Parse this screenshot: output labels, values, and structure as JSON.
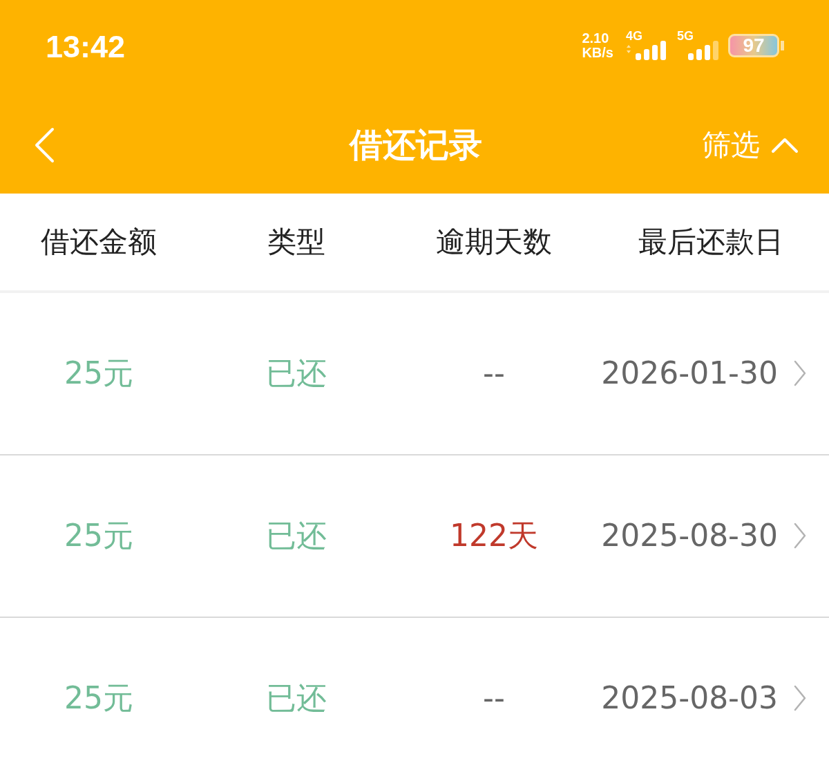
{
  "status_bar": {
    "time": "13:42",
    "network_speed": {
      "value": "2.10",
      "unit": "KB/s"
    },
    "signals": [
      {
        "label": "4G",
        "kind": "active"
      },
      {
        "label": "5G",
        "kind": "idle"
      }
    ],
    "battery": {
      "percent": "97"
    }
  },
  "nav_bar": {
    "title": "借还记录",
    "filter": {
      "label": "筛选",
      "expanded": true
    }
  },
  "table": {
    "columns": [
      "借还金额",
      "类型",
      "逾期天数",
      "最后还款日"
    ],
    "rows": [
      {
        "amount": "25元",
        "type": "已还",
        "overdue_days": "--",
        "overdue": false,
        "due_date": "2026-01-30"
      },
      {
        "amount": "25元",
        "type": "已还",
        "overdue_days": "122天",
        "overdue": true,
        "due_date": "2025-08-30"
      },
      {
        "amount": "25元",
        "type": "已还",
        "overdue_days": "--",
        "overdue": false,
        "due_date": "2025-08-03"
      }
    ]
  }
}
